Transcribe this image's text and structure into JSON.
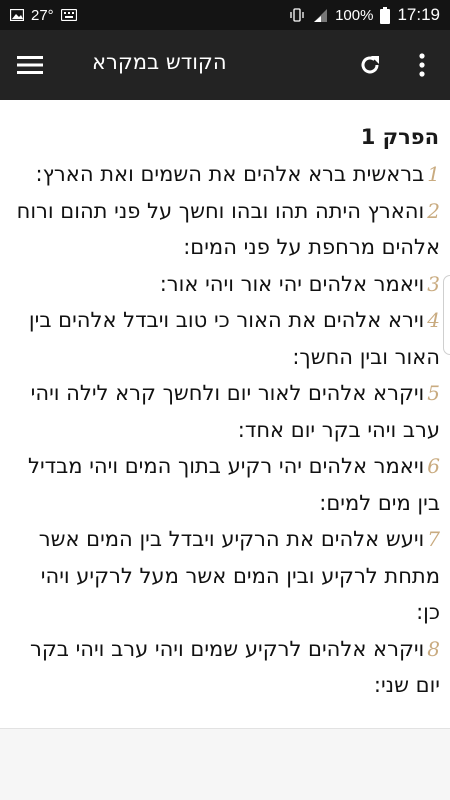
{
  "status_bar": {
    "temperature": "27°",
    "battery": "100%",
    "time": "17:19",
    "icons": [
      "image-icon",
      "keyboard-icon",
      "vibrate-icon",
      "signal-icon",
      "battery-icon"
    ]
  },
  "app_bar": {
    "title": "הקודש במקרא",
    "icons": [
      "menu-icon",
      "refresh-icon",
      "more-vert-icon"
    ]
  },
  "chapter": {
    "title": "הפרק 1",
    "verses": [
      {
        "num": "1",
        "text": "בראשית ברא אלהים את השמים ואת הארץ:"
      },
      {
        "num": "2",
        "text": "והארץ היתה תהו ובהו וחשך על פני תהום ורוח אלהים מרחפת על פני המים:"
      },
      {
        "num": "3",
        "text": "ויאמר אלהים יהי אור ויהי אור:"
      },
      {
        "num": "4",
        "text": "וירא אלהים את האור כי טוב ויבדל אלהים בין האור ובין החשך:"
      },
      {
        "num": "5",
        "text": "ויקרא אלהים לאור יום ולחשך קרא לילה ויהי ערב ויהי בקר יום אחד:"
      },
      {
        "num": "6",
        "text": "ויאמר אלהים יהי רקיע בתוך המים ויהי מבדיל בין מים למים:"
      },
      {
        "num": "7",
        "text": "ויעש אלהים את הרקיע ויבדל בין המים אשר מתחת לרקיע ובין המים אשר מעל לרקיע ויהי כן:"
      },
      {
        "num": "8",
        "text": "ויקרא אלהים לרקיע שמים ויהי ערב ויהי בקר יום שני:"
      }
    ]
  },
  "colors": {
    "status_bar_bg": "#141414",
    "app_bar_bg": "#232323",
    "verse_number": "#c9ab80",
    "text": "#111111"
  }
}
